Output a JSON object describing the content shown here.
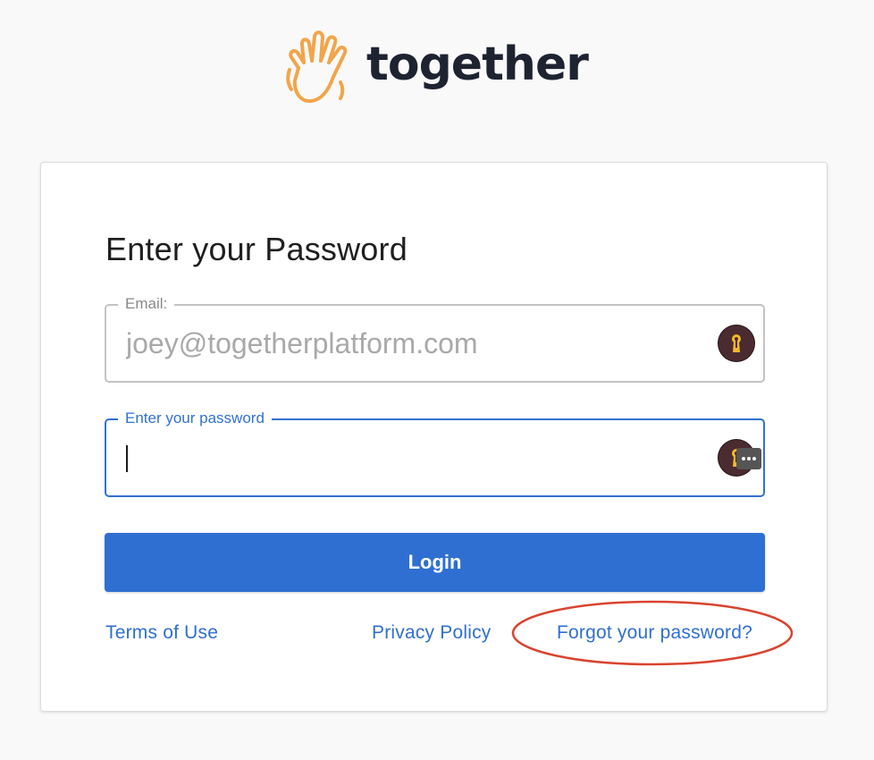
{
  "brand": {
    "name": "together",
    "logo_icon": "waving-hand-icon",
    "logo_color": "#f2a54a"
  },
  "card": {
    "title": "Enter your Password",
    "email_field": {
      "label": "Email:",
      "value": "",
      "placeholder": "joey@togetherplatform.com",
      "badge_icon": "password-manager-keyhole-icon"
    },
    "password_field": {
      "label": "Enter your password",
      "value": "",
      "badge_icon": "password-manager-keyhole-icon",
      "more_icon": "more-options-icon",
      "focused": true
    },
    "login_button": {
      "label": "Login",
      "color": "#2f6fd2"
    },
    "links": {
      "terms": "Terms of Use",
      "privacy": "Privacy Policy",
      "forgot": "Forgot your password?"
    }
  },
  "annotation": {
    "shape": "ellipse",
    "color": "#d9432f",
    "target": "forgot-password-link"
  }
}
